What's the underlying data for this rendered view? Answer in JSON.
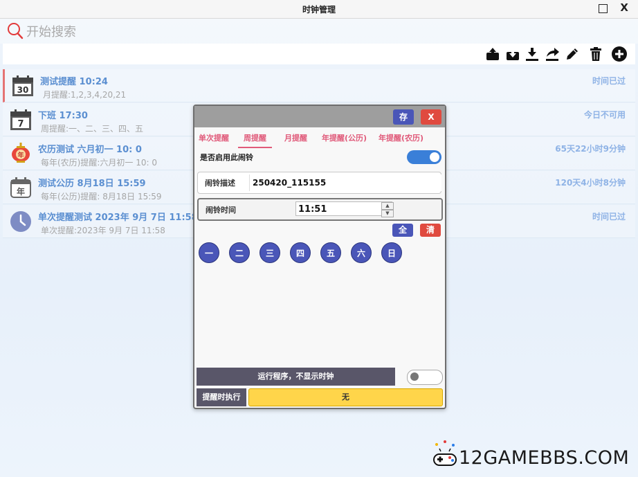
{
  "window": {
    "title": "时钟管理"
  },
  "search": {
    "placeholder": "开始搜索"
  },
  "toolbar": {
    "icons": [
      "upload-icon",
      "download-icon",
      "import-icon",
      "share-icon",
      "edit-icon",
      "delete-icon",
      "add-icon"
    ]
  },
  "alarms": [
    {
      "icon": "calendar-30-icon",
      "icon_text": "30",
      "name": "测试提醒 10:24",
      "detail": "月提醒:1,2,3,4,20,21",
      "status": "时间已过"
    },
    {
      "icon": "calendar-7-icon",
      "icon_text": "7",
      "name": "下班 17:30",
      "detail": "周提醒:一、二、三、四、五",
      "status": "今日不可用"
    },
    {
      "icon": "lunar-lantern-icon",
      "icon_text": "年",
      "name": "农历测试 六月初一 10: 0",
      "detail": "每年(农历)提醒:六月初一 10: 0",
      "status": "65天22小时9分钟"
    },
    {
      "icon": "calendar-year-icon",
      "icon_text": "年",
      "name": "测试公历  8月18日 15:59",
      "detail": "每年(公历)提醒: 8月18日 15:59",
      "status": "120天4小时8分钟"
    },
    {
      "icon": "clock-icon",
      "icon_text": "",
      "name": "单次提醒测试 2023年 9月 7日 11:58",
      "detail": "单次提醒:2023年 9月 7日 11:58",
      "status": "时间已过"
    }
  ],
  "dialog": {
    "save_label": "存",
    "close_label": "X",
    "tabs": [
      "单次提醒",
      "周提醒",
      "月提醒",
      "年提醒(公历)",
      "年提醒(农历)"
    ],
    "active_tab": "周提醒",
    "enable_label": "是否启用此闹铃",
    "enabled": true,
    "desc_label": "闹铃描述",
    "desc_value": "250420_115155",
    "time_label": "闹铃时间",
    "time_value": "11:51",
    "all_label": "全",
    "clear_label": "清",
    "days": [
      "一",
      "二",
      "三",
      "四",
      "五",
      "六",
      "日"
    ],
    "run_label": "运行程序，不显示时钟",
    "run_toggle": false,
    "exec_label": "提醒时执行",
    "exec_value": "无"
  },
  "watermark": {
    "text": "12GAMEBBS.COM"
  },
  "colors": {
    "accent": "#4a56b8",
    "danger": "#e04a3f",
    "tab": "#e05a7a",
    "status": "#8fb3e6",
    "name": "#5b8fd1",
    "exec": "#ffd54a"
  }
}
